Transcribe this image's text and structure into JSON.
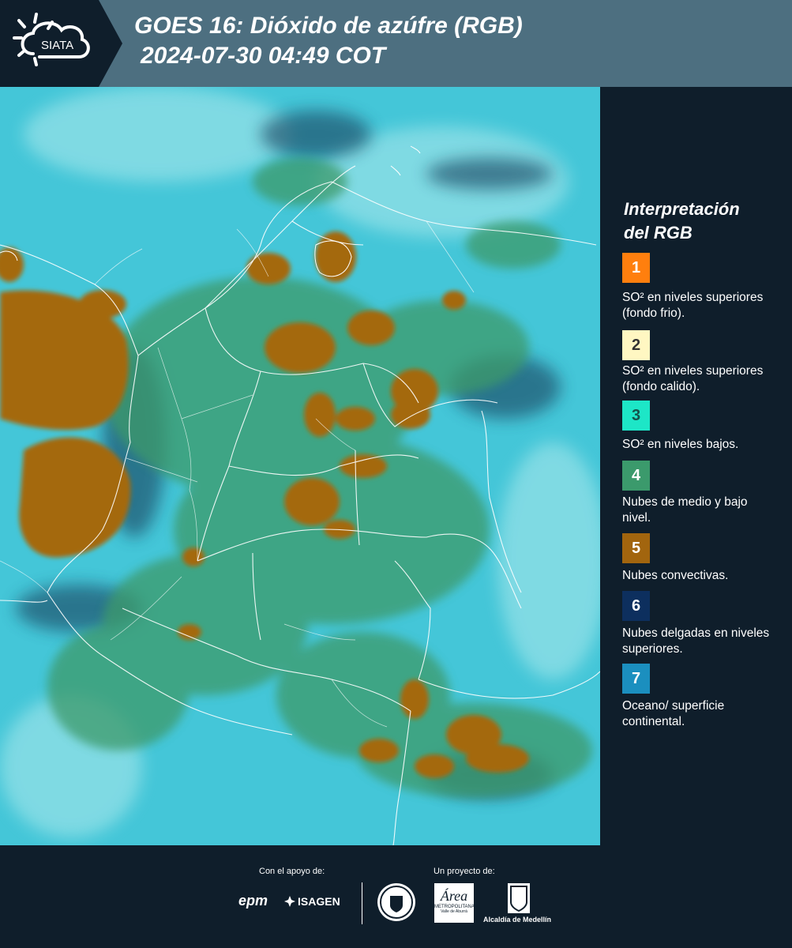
{
  "header": {
    "logo_text": "SIATA",
    "title_line1": "GOES 16: Dióxido de azúfre (RGB)",
    "title_line2": "2024-07-30 04:49 COT"
  },
  "legend": {
    "title_line1": "Interpretación",
    "title_line2": "del RGB",
    "items": [
      {
        "number": "1",
        "color": "#ff7f0e",
        "label": "SO² en niveles superiores (fondo frio)."
      },
      {
        "number": "2",
        "color": "#fff7c2",
        "label": "SO² en niveles superiores (fondo calido)."
      },
      {
        "number": "3",
        "color": "#1de6c7",
        "label": "SO² en niveles bajos."
      },
      {
        "number": "4",
        "color": "#3b9a6c",
        "label": "Nubes de medio y bajo nivel."
      },
      {
        "number": "5",
        "color": "#a2650e",
        "label": "Nubes convectivas."
      },
      {
        "number": "6",
        "color": "#0d2f5e",
        "label": "Nubes delgadas en niveles superiores."
      },
      {
        "number": "7",
        "color": "#1b8fbf",
        "label": "Oceano/ superficie continental."
      }
    ]
  },
  "footer": {
    "support_label": "Con el apoyo de:",
    "project_label": "Un proyecto de:",
    "epm_logo": "epm",
    "isagen_logo": "ISAGEN",
    "area_logo": "Área",
    "area_sub": "METROPOLITANA",
    "area_sub2": "Valle de Aburrá",
    "alcaldia_logo": "Alcaldía de Medellín"
  },
  "colors": {
    "background": "#0f1e2b",
    "header": "#4d6f80",
    "ocean": "#3fc4d6",
    "convective": "#a2650e",
    "midcloud": "#3b9a6c"
  }
}
